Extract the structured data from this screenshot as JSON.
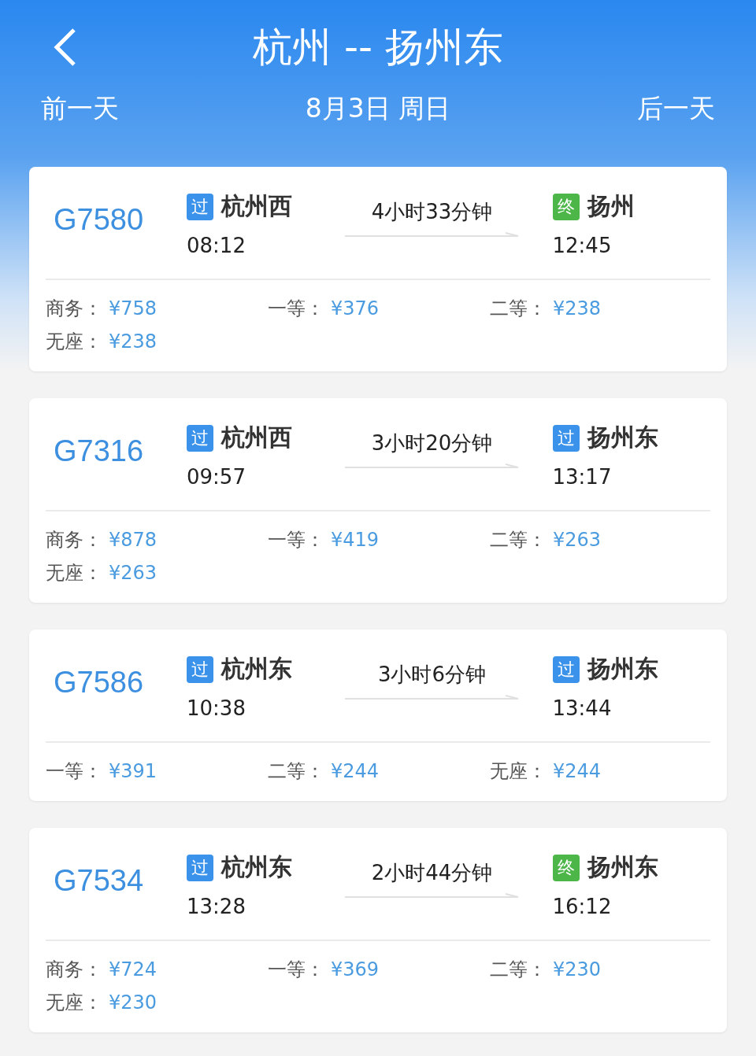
{
  "header": {
    "title": "杭州 -- 扬州东",
    "prev_day": "前一天",
    "date": "8月3日 周日",
    "next_day": "后一天"
  },
  "trains": [
    {
      "number": "G7580",
      "from": {
        "badge": "过",
        "kind": "pass",
        "station": "杭州西",
        "time": "08:12"
      },
      "duration": "4小时33分钟",
      "to": {
        "badge": "终",
        "kind": "end",
        "station": "扬州",
        "time": "12:45"
      },
      "prices": [
        {
          "label": "商务：",
          "price": "¥758"
        },
        {
          "label": "一等：",
          "price": "¥376"
        },
        {
          "label": "二等：",
          "price": "¥238"
        },
        {
          "label": "无座：",
          "price": "¥238"
        }
      ]
    },
    {
      "number": "G7316",
      "from": {
        "badge": "过",
        "kind": "pass",
        "station": "杭州西",
        "time": "09:57"
      },
      "duration": "3小时20分钟",
      "to": {
        "badge": "过",
        "kind": "pass",
        "station": "扬州东",
        "time": "13:17"
      },
      "prices": [
        {
          "label": "商务：",
          "price": "¥878"
        },
        {
          "label": "一等：",
          "price": "¥419"
        },
        {
          "label": "二等：",
          "price": "¥263"
        },
        {
          "label": "无座：",
          "price": "¥263"
        }
      ]
    },
    {
      "number": "G7586",
      "from": {
        "badge": "过",
        "kind": "pass",
        "station": "杭州东",
        "time": "10:38"
      },
      "duration": "3小时6分钟",
      "to": {
        "badge": "过",
        "kind": "pass",
        "station": "扬州东",
        "time": "13:44"
      },
      "prices": [
        {
          "label": "一等：",
          "price": "¥391"
        },
        {
          "label": "二等：",
          "price": "¥244"
        },
        {
          "label": "无座：",
          "price": "¥244"
        }
      ]
    },
    {
      "number": "G7534",
      "from": {
        "badge": "过",
        "kind": "pass",
        "station": "杭州东",
        "time": "13:28"
      },
      "duration": "2小时44分钟",
      "to": {
        "badge": "终",
        "kind": "end",
        "station": "扬州东",
        "time": "16:12"
      },
      "prices": [
        {
          "label": "商务：",
          "price": "¥724"
        },
        {
          "label": "一等：",
          "price": "¥369"
        },
        {
          "label": "二等：",
          "price": "¥230"
        },
        {
          "label": "无座：",
          "price": "¥230"
        }
      ]
    }
  ]
}
